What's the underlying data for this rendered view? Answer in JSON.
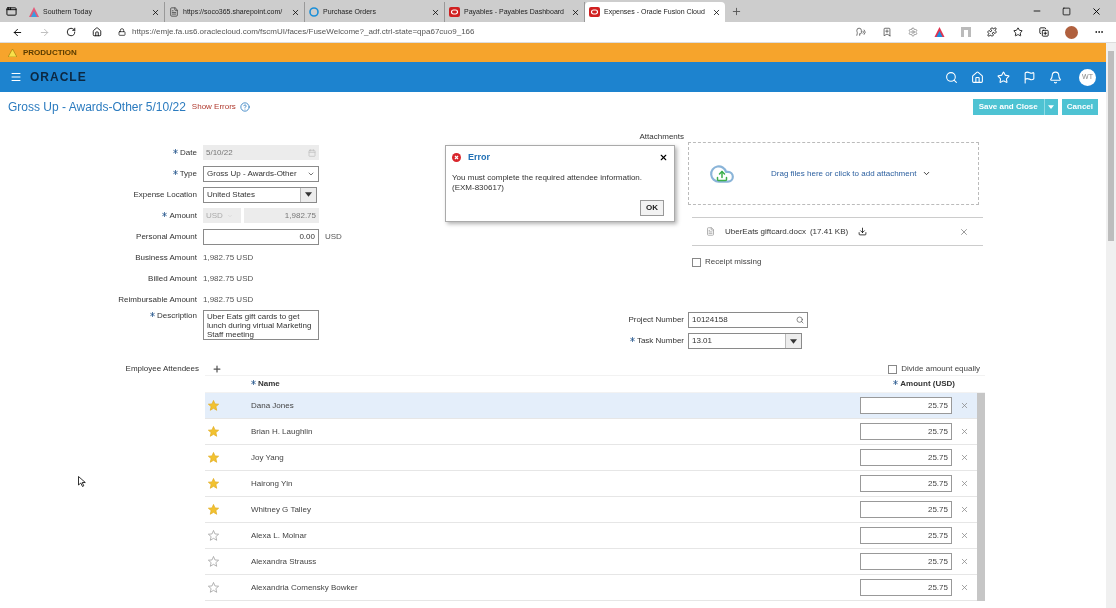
{
  "browser": {
    "tabs": [
      {
        "title": "Southern Today",
        "selected": false
      },
      {
        "title": "https://soco365.sharepoint.com/",
        "selected": false
      },
      {
        "title": "Purchase Orders",
        "selected": false
      },
      {
        "title": "Payables - Payables Dashboard",
        "selected": false
      },
      {
        "title": "Expenses - Oracle Fusion Cloud",
        "selected": true
      }
    ],
    "url": "https://emje.fa.us6.oraclecloud.com/fscmUI/faces/FuseWelcome?_adf.ctrl-state=qpa67cuo9_166"
  },
  "environment_banner": "PRODUCTION",
  "header": {
    "logo": "ORACLE",
    "avatar": "WT"
  },
  "page": {
    "title": "Gross Up - Awards-Other 5/10/22",
    "show_errors": "Show Errors",
    "buttons": [
      "Save and Close",
      "Cancel"
    ]
  },
  "form": [
    {
      "label": "Date",
      "required": true,
      "kind": "date",
      "value": "5/10/22",
      "disabled": true
    },
    {
      "label": "Type",
      "required": true,
      "kind": "select",
      "value": "Gross Up - Awards-Other"
    },
    {
      "label": "Expense Location",
      "required": false,
      "kind": "combo",
      "value": "United States"
    },
    {
      "label": "Amount",
      "required": true,
      "kind": "currency",
      "currency": "USD",
      "value": "1,982.75",
      "disabled": true
    },
    {
      "label": "Personal Amount",
      "required": false,
      "kind": "number",
      "value": "0.00",
      "unit": "USD"
    },
    {
      "label": "Business Amount",
      "required": false,
      "kind": "text",
      "value": "1,982.75 USD"
    },
    {
      "label": "Billed Amount",
      "required": false,
      "kind": "text",
      "value": "1,982.75 USD"
    },
    {
      "label": "Reimbursable Amount",
      "required": false,
      "kind": "text",
      "value": "1,982.75 USD"
    },
    {
      "label": "Description",
      "required": true,
      "kind": "textarea",
      "value": "Uber Eats gift cards to get lunch during virtual Marketing Staff meeting"
    }
  ],
  "attachments": {
    "label": "Attachments",
    "dropzone": "Drag files here or click to add attachment",
    "file": {
      "name": "UberEats giftcard.docx",
      "size": "(17.41 KB)"
    },
    "receipt_missing": {
      "label": "Receipt missing",
      "checked": false
    }
  },
  "project": [
    {
      "label": "Project Number",
      "required": false,
      "kind": "search",
      "value": "10124158"
    },
    {
      "label": "Task Number",
      "required": true,
      "kind": "combo",
      "value": "13.01"
    }
  ],
  "attendees": {
    "label": "Employee Attendees",
    "divide": {
      "label": "Divide amount equally",
      "checked": false
    },
    "columns": [
      {
        "label": "Name",
        "required": true
      },
      {
        "label": "Amount (USD)",
        "required": true
      }
    ],
    "rows": [
      {
        "name": "Dana Jones",
        "favorite": true,
        "amount": "25.75",
        "selected": true
      },
      {
        "name": "Brian H. Laughlin",
        "favorite": true,
        "amount": "25.75",
        "selected": false
      },
      {
        "name": "Joy Yang",
        "favorite": true,
        "amount": "25.75",
        "selected": false
      },
      {
        "name": "Hairong Yin",
        "favorite": true,
        "amount": "25.75",
        "selected": false
      },
      {
        "name": "Whitney G Talley",
        "favorite": true,
        "amount": "25.75",
        "selected": false
      },
      {
        "name": "Alexa L. Molnar",
        "favorite": false,
        "amount": "25.75",
        "selected": false
      },
      {
        "name": "Alexandra Strauss",
        "favorite": false,
        "amount": "25.75",
        "selected": false
      },
      {
        "name": "Alexandria Comensky Bowker",
        "favorite": false,
        "amount": "25.75",
        "selected": false
      }
    ]
  },
  "error_dialog": {
    "title": "Error",
    "message": "You must complete the required attendee information. (EXM-830617)",
    "button": "OK"
  }
}
